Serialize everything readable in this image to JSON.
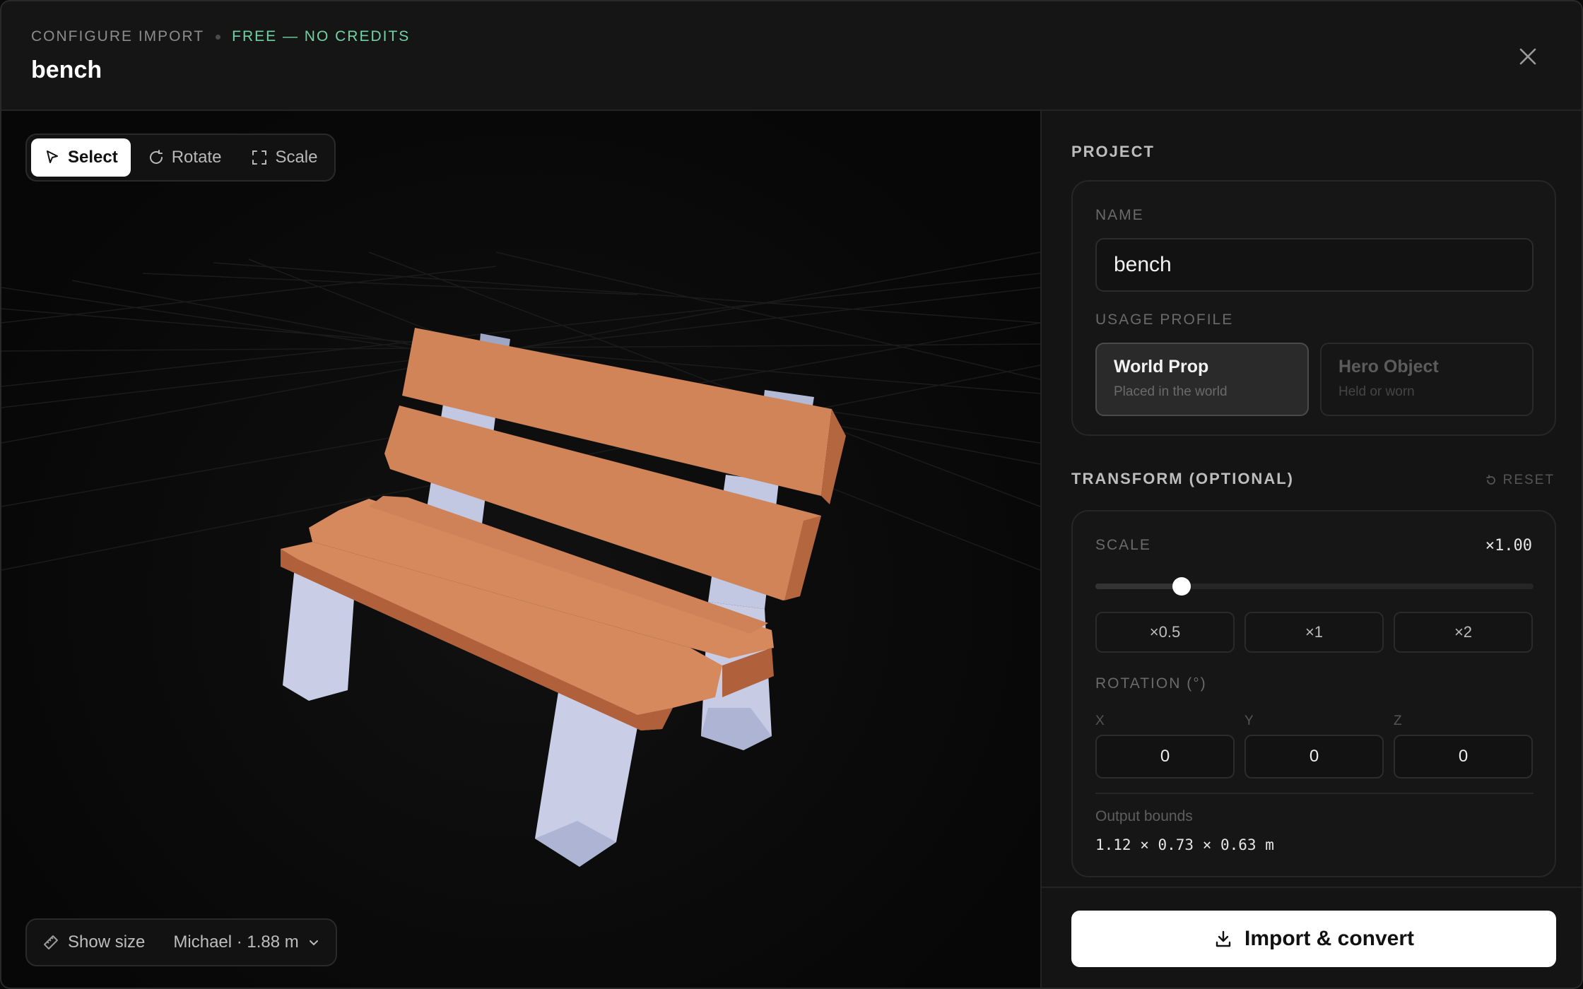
{
  "header": {
    "eyebrow": "CONFIGURE IMPORT",
    "badge": "FREE — NO CREDITS",
    "title": "bench",
    "close_icon": "close-icon"
  },
  "toolbar": {
    "tools": [
      {
        "label": "Select",
        "icon": "cursor-icon",
        "active": true
      },
      {
        "label": "Rotate",
        "icon": "rotate-icon",
        "active": false
      },
      {
        "label": "Scale",
        "icon": "scale-icon",
        "active": false
      }
    ]
  },
  "viewer": {
    "show_size_label": "Show size",
    "reference_label": "Michael · 1.88 m"
  },
  "panel": {
    "project_title": "PROJECT",
    "name_label": "NAME",
    "name_value": "bench",
    "usage_label": "USAGE PROFILE",
    "profiles": [
      {
        "title": "World Prop",
        "subtitle": "Placed in the world",
        "selected": true
      },
      {
        "title": "Hero Object",
        "subtitle": "Held or worn",
        "selected": false
      }
    ],
    "transform_title": "TRANSFORM (OPTIONAL)",
    "reset_label": "RESET",
    "scale_label": "SCALE",
    "scale_value": "×1.00",
    "scale_fraction": 0.197,
    "presets": [
      "×0.5",
      "×1",
      "×2"
    ],
    "rotation_label": "ROTATION (°)",
    "rotation": {
      "x_label": "X",
      "y_label": "Y",
      "z_label": "Z",
      "x": "0",
      "y": "0",
      "z": "0"
    },
    "bounds_label": "Output bounds",
    "bounds_value": "1.12 × 0.73 × 0.63 m"
  },
  "footer": {
    "import_label": "Import & convert"
  },
  "colors": {
    "accent_green": "#6fd3a3",
    "wood": "#d08458",
    "metal": "#c7cce4"
  }
}
